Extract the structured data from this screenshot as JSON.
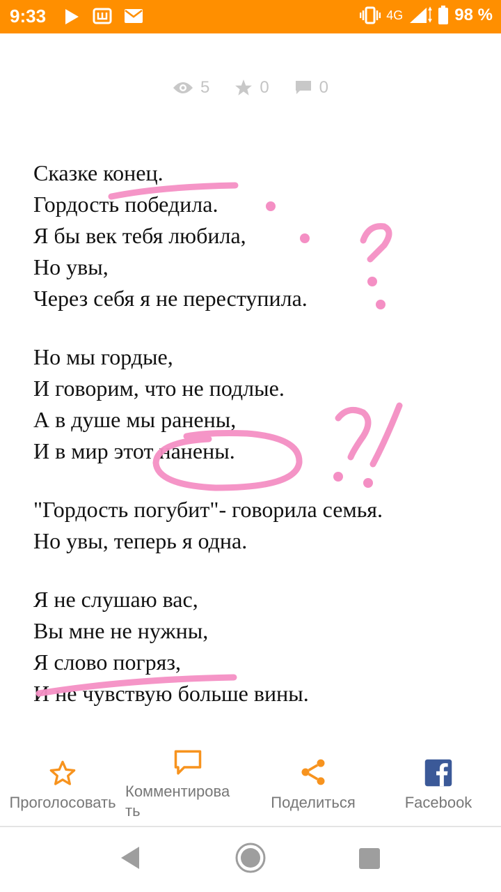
{
  "status_bar": {
    "time": "9:33",
    "network": "4G",
    "battery": "98 %",
    "icons": [
      "play-icon",
      "sim-icon",
      "mail-icon",
      "vibrate-icon",
      "signal-icon",
      "battery-icon"
    ],
    "color": "#ff8f00"
  },
  "stats": {
    "views": "5",
    "stars": "0",
    "comments": "0"
  },
  "poem": {
    "stanzas": [
      {
        "lines": [
          "Сказке конец.",
          "Гордость победила.",
          "Я бы век тебя любила,",
          "Но увы,",
          "Через себя я не переступила."
        ]
      },
      {
        "lines": [
          "Но мы гордые,",
          "И говорим, что не подлые.",
          "А в душе мы ранены,",
          "И в мир этот нанены."
        ]
      },
      {
        "lines": [
          "\"Гордость погубит\"- говорила семья.",
          "Но увы, теперь я одна."
        ]
      },
      {
        "lines": [
          "Я не слушаю вас,",
          "Вы мне не нужны,",
          "Я слово погряз,",
          "И не чувствую больше вины."
        ]
      }
    ]
  },
  "annotations": {
    "color": "#f48fc4",
    "marks": [
      "?",
      "?!"
    ]
  },
  "actions": {
    "vote": "Проголосовать",
    "comment_line1": "Комментирова",
    "comment_line2": "ть",
    "share": "Поделиться",
    "facebook": "Facebook",
    "accent": "#f7931e"
  },
  "navbar": {
    "icons": [
      "back-icon",
      "home-icon",
      "recents-icon"
    ]
  }
}
